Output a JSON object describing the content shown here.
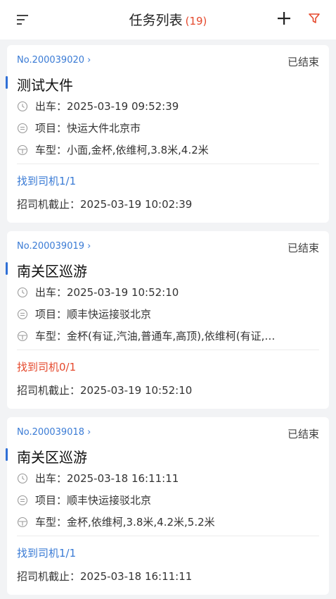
{
  "header": {
    "title": "任务列表",
    "count": "(19)",
    "accent_color": "#e5492d"
  },
  "cards": [
    {
      "number": "No.200039020 ›",
      "status": "已结束",
      "title": "测试大件",
      "departure": "出车：2025-03-19 09:52:39",
      "project": "项目：快运大件北京市",
      "vehicle": "车型：小面,金杯,依维柯,3.8米,4.2米",
      "drivers": "找到司机1/1",
      "drivers_color": "#3a7bd5",
      "deadline": "招司机截止：2025-03-19 10:02:39"
    },
    {
      "number": "No.200039019 ›",
      "status": "已结束",
      "title": "南关区巡游",
      "departure": "出车：2025-03-19 10:52:10",
      "project": "项目：顺丰快运接驳北京",
      "vehicle": "车型：金杯(有证,汽油,普通车,高顶),依维柯(有证,…",
      "drivers": "找到司机0/1",
      "drivers_color": "#e5492d",
      "deadline": "招司机截止：2025-03-19 10:52:10"
    },
    {
      "number": "No.200039018 ›",
      "status": "已结束",
      "title": "南关区巡游",
      "departure": "出车：2025-03-18 16:11:11",
      "project": "项目：顺丰快运接驳北京",
      "vehicle": "车型：金杯,依维柯,3.8米,4.2米,5.2米",
      "drivers": "找到司机1/1",
      "drivers_color": "#3a7bd5",
      "deadline": "招司机截止：2025-03-18 16:11:11"
    }
  ]
}
